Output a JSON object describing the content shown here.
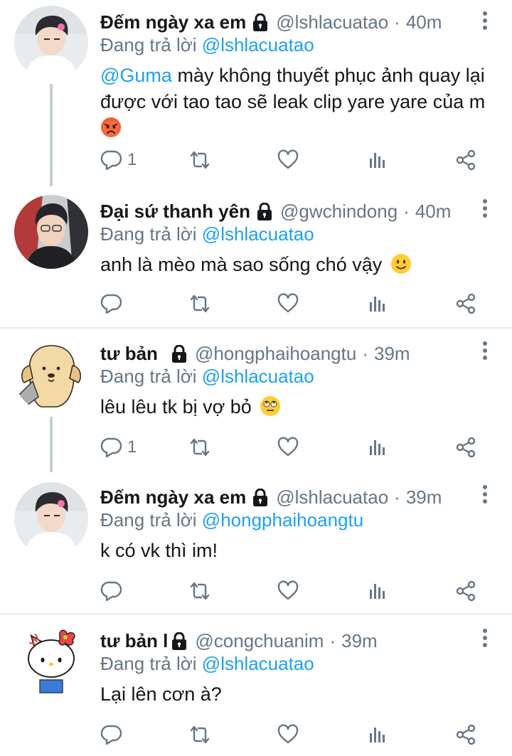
{
  "reply_prefix": "Đang trả lời",
  "tweets": [
    {
      "name": "Đếm ngày xa em",
      "handle": "@lshlacuatao",
      "time": "40m",
      "reply_to": "@lshlacuatao",
      "mention": "@Guma",
      "text": "mày không thuyết phục ảnh quay lại được với tao tao sẽ leak clip yare yare của m",
      "emoji": "angry-face-emoji",
      "reply_count": "1"
    },
    {
      "name": "Đại sứ thanh yên",
      "handle": "@gwchindong",
      "time": "40m",
      "reply_to": "@lshlacuatao",
      "text": "anh là mèo mà sao sống chó vậy",
      "emoji": "slightly-smiling-face-emoji",
      "reply_count": ""
    },
    {
      "name": "tư bản",
      "handle": "@hongphaihoangtu",
      "time": "39m",
      "reply_to": "@lshlacuatao",
      "text": "lêu lêu tk bị vợ bỏ",
      "emoji": "eye-roll-face-emoji",
      "reply_count": "1"
    },
    {
      "name": "Đếm ngày xa em",
      "handle": "@lshlacuatao",
      "time": "39m",
      "reply_to": "@hongphaihoangtu",
      "text": "k có vk thì im!",
      "reply_count": ""
    },
    {
      "name": "tư bản l",
      "handle": "@congchuanim",
      "time": "39m",
      "reply_to": "@lshlacuatao",
      "text": "Lại lên cơn à?",
      "reply_count": ""
    }
  ],
  "colors": {
    "link": "#1da1f2",
    "secondary_text": "#657786",
    "divider": "#e6ecf0",
    "thread_line": "#c4cfd6"
  },
  "icons": [
    "lock-icon",
    "more-vertical-icon",
    "reply-icon",
    "retweet-icon",
    "like-icon",
    "analytics-icon",
    "share-icon"
  ]
}
